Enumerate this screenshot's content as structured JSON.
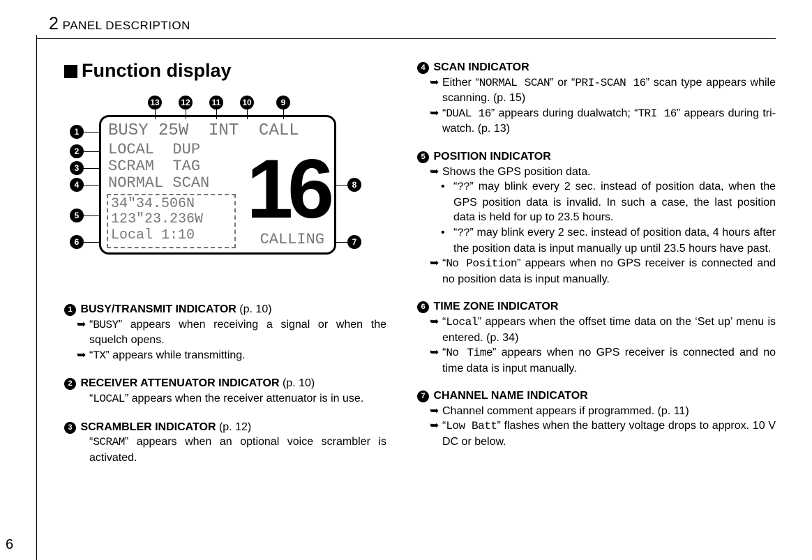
{
  "header": {
    "chapter_num": "2",
    "chapter_title": "PANEL DESCRIPTION"
  },
  "page_number": "6",
  "section_title": "Function display",
  "lcd": {
    "row1": "BUSY 25W  INT  CALL",
    "row2": "LOCAL  DUP",
    "row3": "SCRAM  TAG",
    "row4": "NORMAL SCAN",
    "big_channel": "16",
    "pos_line1": " 34\"34.506N",
    "pos_line2": "123\"23.236W",
    "pos_line3": "Local  1:10",
    "calling": "CALLING",
    "callouts": {
      "1": "1",
      "2": "2",
      "3": "3",
      "4": "4",
      "5": "5",
      "6": "6",
      "7": "7",
      "8": "8",
      "9": "9",
      "10": "10",
      "11": "11",
      "12": "12",
      "13": "13"
    }
  },
  "left_items": [
    {
      "num": "1",
      "title": "BUSY/TRANSMIT INDICATOR",
      "title_suffix": " (p. 10)",
      "subs": [
        {
          "kind": "arrow",
          "pre": "“",
          "mono": "BUSY",
          "post": "” appears when receiving a signal or when the squelch opens."
        },
        {
          "kind": "arrow",
          "pre": "“",
          "mono": "TX",
          "post": "” appears while transmitting."
        }
      ]
    },
    {
      "num": "2",
      "title": "RECEIVER ATTENUATOR INDICATOR",
      "title_suffix": " (p. 10)",
      "subs": [
        {
          "kind": "plain",
          "pre": "“",
          "mono": "LOCAL",
          "post": "” appears when the receiver attenuator is in use."
        }
      ]
    },
    {
      "num": "3",
      "title": "SCRAMBLER INDICATOR",
      "title_suffix": " (p. 12)",
      "subs": [
        {
          "kind": "plain",
          "pre": "“",
          "mono": "SCRAM",
          "post": "” appears when an optional voice scrambler is activated."
        }
      ]
    }
  ],
  "right_items": [
    {
      "num": "4",
      "title": "SCAN INDICATOR",
      "title_suffix": "",
      "subs": [
        {
          "kind": "arrow",
          "pre": "Either “",
          "mono": "NORMAL SCAN",
          "mid": "” or “",
          "mono2": "PRI-SCAN 16",
          "post": "” scan type appears while scanning. (p. 15)"
        },
        {
          "kind": "arrow",
          "pre": "“",
          "mono": "DUAL   16",
          "mid": "” appears during dualwatch; “",
          "mono2": "TRI   16",
          "post": "” appears during tri-watch. (p. 13)"
        }
      ]
    },
    {
      "num": "5",
      "title": "POSITION INDICATOR",
      "title_suffix": "",
      "subs": [
        {
          "kind": "arrow",
          "pre": "",
          "mono": "",
          "post": "Shows the GPS position data."
        },
        {
          "kind": "dot",
          "pre": "“",
          "mono": "??",
          "post": "” may blink every 2 sec. instead of position data, when the GPS position data is invalid. In such a case, the last position data is held for up to 23.5 hours."
        },
        {
          "kind": "dot",
          "pre": "“",
          "mono": "??",
          "post": "” may blink every 2 sec. instead of position data, 4 hours after the position data is input manually up until 23.5 hours have past."
        },
        {
          "kind": "arrow",
          "pre": "“",
          "mono": "No Position",
          "post": "” appears when no GPS receiver is connected and no position data is input manually."
        }
      ]
    },
    {
      "num": "6",
      "title": "TIME ZONE INDICATOR",
      "title_suffix": "",
      "subs": [
        {
          "kind": "arrow",
          "pre": "“",
          "mono": "Local",
          "post": "” appears when the offset time data on the ‘Set up’ menu is entered. (p. 34)"
        },
        {
          "kind": "arrow",
          "pre": "“",
          "mono": "No Time",
          "post": "” appears when no GPS receiver is connected and no time data is input manually."
        }
      ]
    },
    {
      "num": "7",
      "title": "CHANNEL NAME INDICATOR",
      "title_suffix": "",
      "subs": [
        {
          "kind": "arrow",
          "pre": "",
          "mono": "",
          "post": "Channel comment appears if programmed. (p. 11)"
        },
        {
          "kind": "arrow",
          "pre": "“",
          "mono": "Low Batt",
          "post": "” flashes when the battery voltage drops to approx. 10 V DC or below."
        }
      ]
    }
  ]
}
